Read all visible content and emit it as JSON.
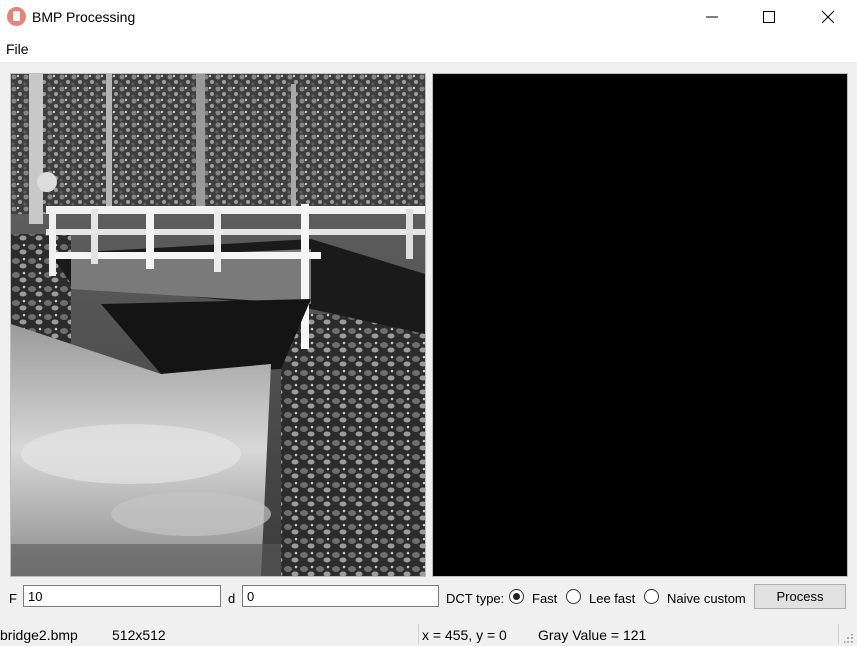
{
  "window": {
    "title": "BMP Processing",
    "app_icon": "bmp-app-icon",
    "accent": "#e8817a"
  },
  "menu": {
    "items": [
      "File"
    ]
  },
  "images": {
    "original": "bridge-photo-grayscale",
    "processed_fill": "#000000"
  },
  "controls": {
    "f_label": "F",
    "f_value": "10",
    "d_label": "d",
    "d_value": "0",
    "dct_label": "DCT type:",
    "dct_options": [
      "Fast",
      "Lee fast",
      "Naive custom"
    ],
    "dct_selected": "Fast",
    "process_label": "Process"
  },
  "status": {
    "filename": "bridge2.bmp",
    "dimensions": "512x512",
    "coords": "x = 455, y = 0",
    "gray": "Gray Value = 121"
  }
}
